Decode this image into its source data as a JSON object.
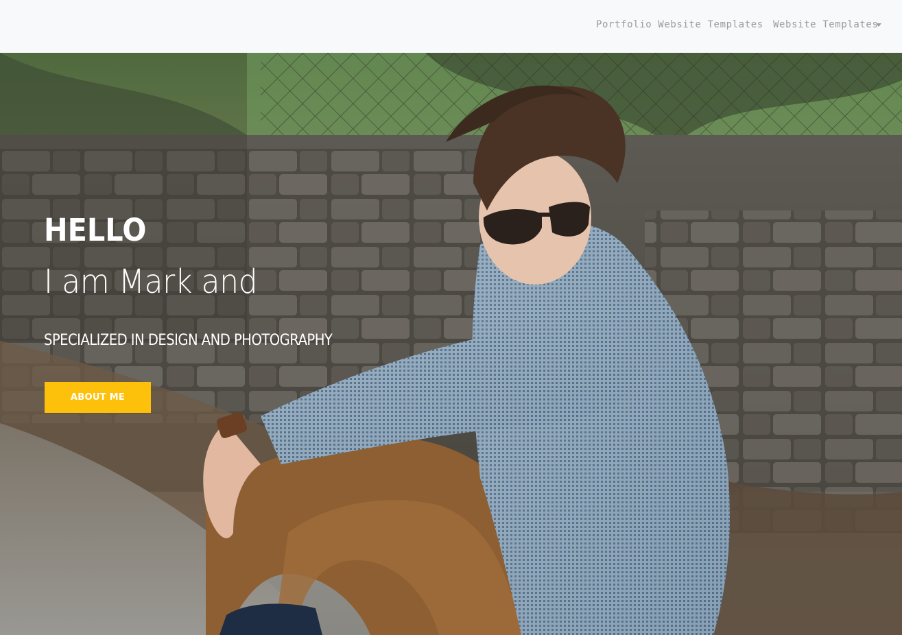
{
  "nav": {
    "links": [
      {
        "label": "Portfolio Website Templates"
      },
      {
        "label": "Website Templates",
        "has_dropdown": true
      }
    ],
    "caret_icon": "caret-down-icon"
  },
  "hero": {
    "greeting": "HELLO",
    "intro": "I am Mark and",
    "tagline": "SPECIALIZED IN DESIGN AND PHOTOGRAPHY",
    "cta_label": "ABOUT ME",
    "cta_color": "#fdc10c",
    "image": "photo of a young man in sunglasses and a checkered shirt sitting in front of a stone wall"
  },
  "colors": {
    "navbar_bg": "#f8f9fa",
    "nav_text": "#9b9b9b",
    "hero_text": "#ffffff",
    "accent": "#fdc10c"
  }
}
